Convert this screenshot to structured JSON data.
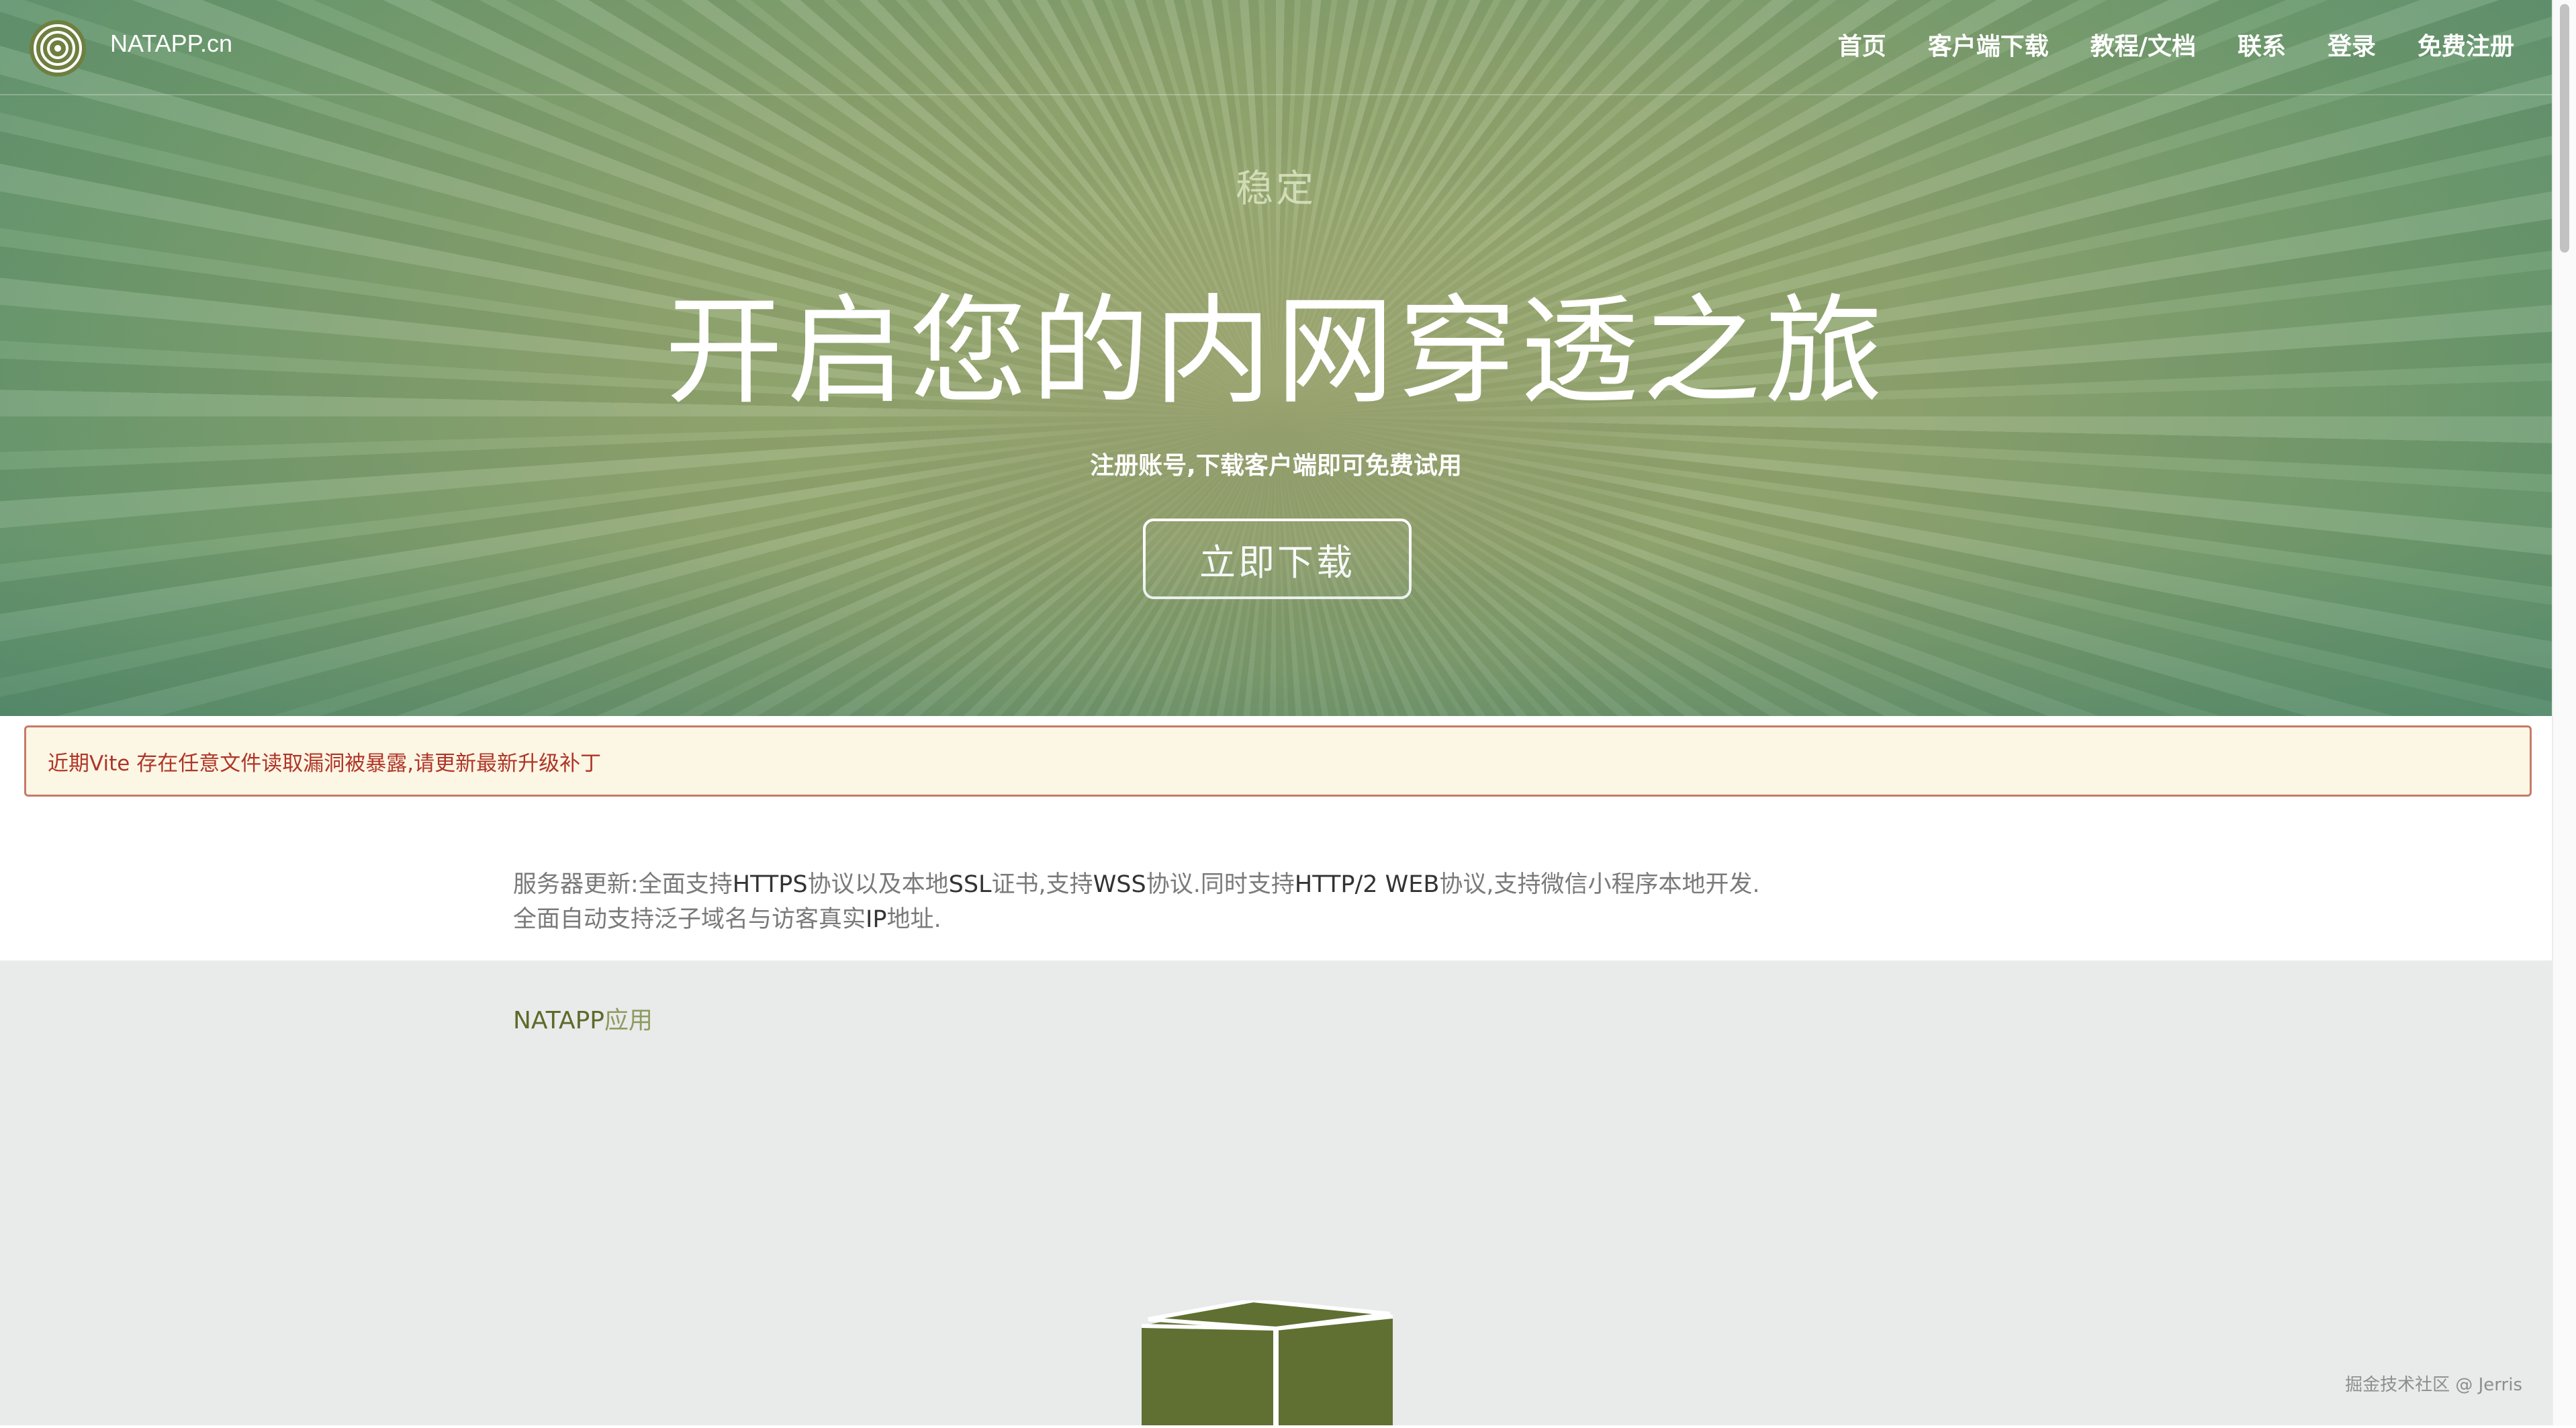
{
  "brand": {
    "name": "NATAPP.cn",
    "logo_icon": "target-rings-logo-icon"
  },
  "nav": {
    "items": [
      "首页",
      "客户端下载",
      "教程/文档",
      "联系",
      "登录",
      "免费注册"
    ]
  },
  "hero": {
    "eyebrow": "稳定",
    "title": "开启您的内网穿透之旅",
    "subtitle": "注册账号,下载客户端即可免费试用",
    "cta_label": "立即下载"
  },
  "alert": {
    "text": "近期Vite 存在任意文件读取漏洞被暴露,请更新最新升级补丁"
  },
  "info": {
    "line1": {
      "p1": "服务器更新:全面支持",
      "k1": "HTTPS",
      "p2": "协议以及本地",
      "k2": "SSL",
      "p3": "证书,支持",
      "k3": "WSS",
      "p4": "协议.同时支持",
      "k4": "HTTP/2 WEB",
      "p5": "协议,支持微信小程序本地开发."
    },
    "line2": {
      "p1": "全面自动支持泛子域名与访客真实",
      "k1": "IP",
      "p2": "地址."
    }
  },
  "apps": {
    "title_strong": "NATAPP",
    "title_light": "应用",
    "icon": "box-cube-icon"
  },
  "watermark": "掘金技术社区 @ Jerris",
  "colors": {
    "brand_green": "#5b6b2a",
    "alert_text": "#b03527",
    "alert_bg": "#fcf6e4",
    "apps_bg": "#e9eaea"
  }
}
